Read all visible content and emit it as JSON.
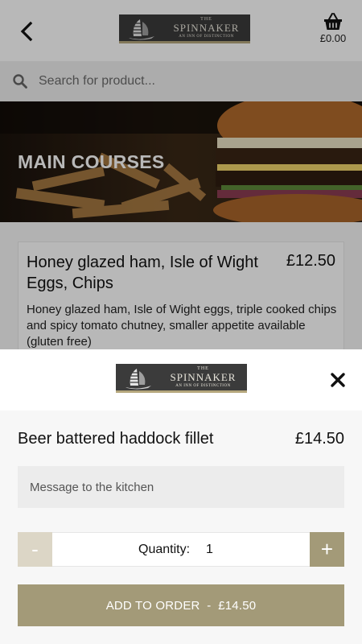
{
  "header": {
    "back_icon": "chevron-left-icon",
    "logo": {
      "the": "THE",
      "name": "SPINNAKER",
      "tagline": "AN INN OF DISTINCTION"
    },
    "basket_icon": "basket-icon",
    "basket_total": "£0.00"
  },
  "search": {
    "placeholder": "Search for product..."
  },
  "hero": {
    "title": "MAIN COURSES"
  },
  "product_card": {
    "title": "Honey glazed ham, Isle of Wight Eggs, Chips",
    "price": "£12.50",
    "description": "Honey glazed ham, Isle of Wight eggs, triple cooked chips and spicy tomato chutney, smaller appetite available (gluten free)"
  },
  "modal": {
    "logo": {
      "the": "THE",
      "name": "SPINNAKER",
      "tagline": "AN INN OF DISTINCTION"
    },
    "close_icon": "close-icon",
    "item_name": "Beer battered haddock fillet",
    "item_price": "£14.50",
    "message_placeholder": "Message to the kitchen",
    "minus_label": "-",
    "plus_label": "+",
    "quantity_label": "Quantity:",
    "quantity_value": "1",
    "add_button_label": "ADD TO ORDER  -  £14.50"
  },
  "colors": {
    "accent": "#a39a78",
    "accent_light": "#dcd6c6",
    "logo_bg": "#3b3b3b"
  }
}
